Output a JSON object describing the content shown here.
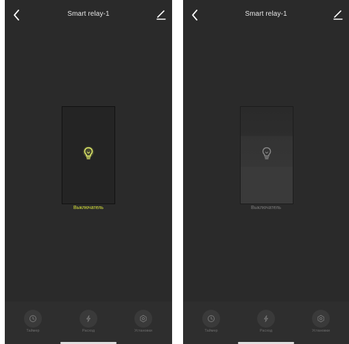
{
  "screens": [
    {
      "state": "on",
      "header": {
        "title": "Smart relay-1"
      },
      "switch": {
        "label": "Выключатель"
      },
      "tabs": [
        {
          "label": "Таймер",
          "icon": "clock-icon"
        },
        {
          "label": "Расход",
          "icon": "lightning-icon"
        },
        {
          "label": "Установки",
          "icon": "settings-icon"
        }
      ]
    },
    {
      "state": "off",
      "header": {
        "title": "Smart relay-1"
      },
      "switch": {
        "label": "Выключатель"
      },
      "tabs": [
        {
          "label": "Таймер",
          "icon": "clock-icon"
        },
        {
          "label": "Расход",
          "icon": "lightning-icon"
        },
        {
          "label": "Установки",
          "icon": "settings-icon"
        }
      ]
    }
  ],
  "colors": {
    "background": "#2a2a2a",
    "bulb_on": "#e4ef6a",
    "bulb_off": "#8a8a8a",
    "label_on": "#d8e33a",
    "label_off": "#7c7c7c"
  }
}
